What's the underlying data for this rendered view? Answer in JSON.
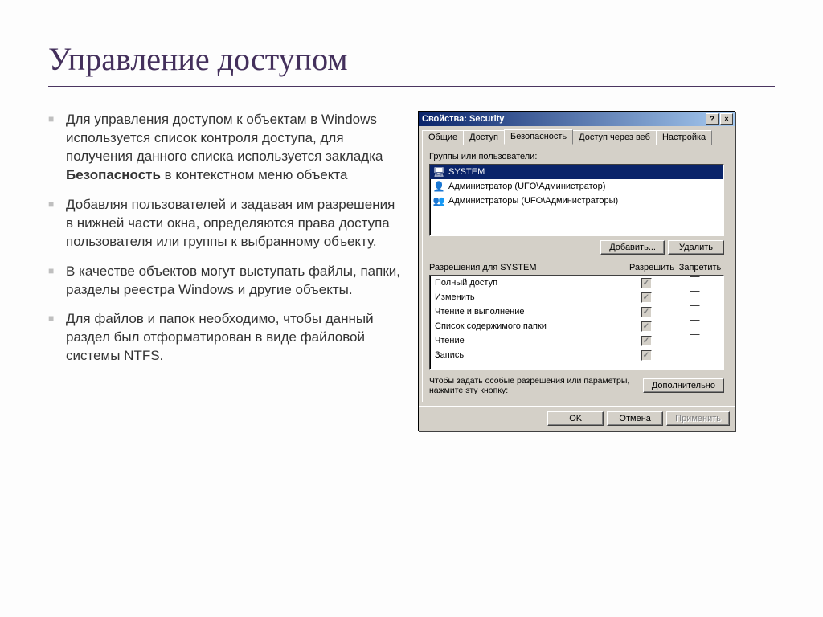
{
  "slide": {
    "title": "Управление доступом",
    "bullets": [
      {
        "pre": "Для управления доступом к объектам в Windows используется список контроля доступа, для получения данного списка используется закладка ",
        "bold": "Безопасность",
        "post": " в контекстном меню объекта"
      },
      {
        "pre": "Добавляя пользователей и задавая им разрешения в нижней части окна, определяются права доступа пользователя или группы к выбранному объекту.",
        "bold": "",
        "post": ""
      },
      {
        "pre": "В качестве объектов могут выступать файлы, папки, разделы реестра Windows и другие объекты.",
        "bold": "",
        "post": ""
      },
      {
        "pre": "Для файлов и папок необходимо, чтобы данный раздел был отформатирован в виде файловой системы NTFS.",
        "bold": "",
        "post": ""
      }
    ]
  },
  "dialog": {
    "title": "Свойства: Security",
    "help_btn": "?",
    "close_btn": "×",
    "tabs": [
      "Общие",
      "Доступ",
      "Безопасность",
      "Доступ через веб",
      "Настройка"
    ],
    "active_tab": 2,
    "groups_label": "Группы или пользователи:",
    "groups": [
      {
        "icon": "computer",
        "label": "SYSTEM",
        "selected": true
      },
      {
        "icon": "user",
        "label": "Администратор (UFO\\Администратор)",
        "selected": false
      },
      {
        "icon": "group",
        "label": "Администраторы (UFO\\Администраторы)",
        "selected": false
      }
    ],
    "add_btn": "Добавить...",
    "remove_btn": "Удалить",
    "perm_label": "Разрешения для SYSTEM",
    "perm_allow": "Разрешить",
    "perm_deny": "Запретить",
    "permissions": [
      {
        "name": "Полный доступ",
        "allow": true,
        "deny": false
      },
      {
        "name": "Изменить",
        "allow": true,
        "deny": false
      },
      {
        "name": "Чтение и выполнение",
        "allow": true,
        "deny": false
      },
      {
        "name": "Список содержимого папки",
        "allow": true,
        "deny": false
      },
      {
        "name": "Чтение",
        "allow": true,
        "deny": false
      },
      {
        "name": "Запись",
        "allow": true,
        "deny": false
      }
    ],
    "adv_text": "Чтобы задать особые разрешения или параметры, нажмите эту кнопку:",
    "adv_btn": "Дополнительно",
    "ok_btn": "OK",
    "cancel_btn": "Отмена",
    "apply_btn": "Применить"
  }
}
